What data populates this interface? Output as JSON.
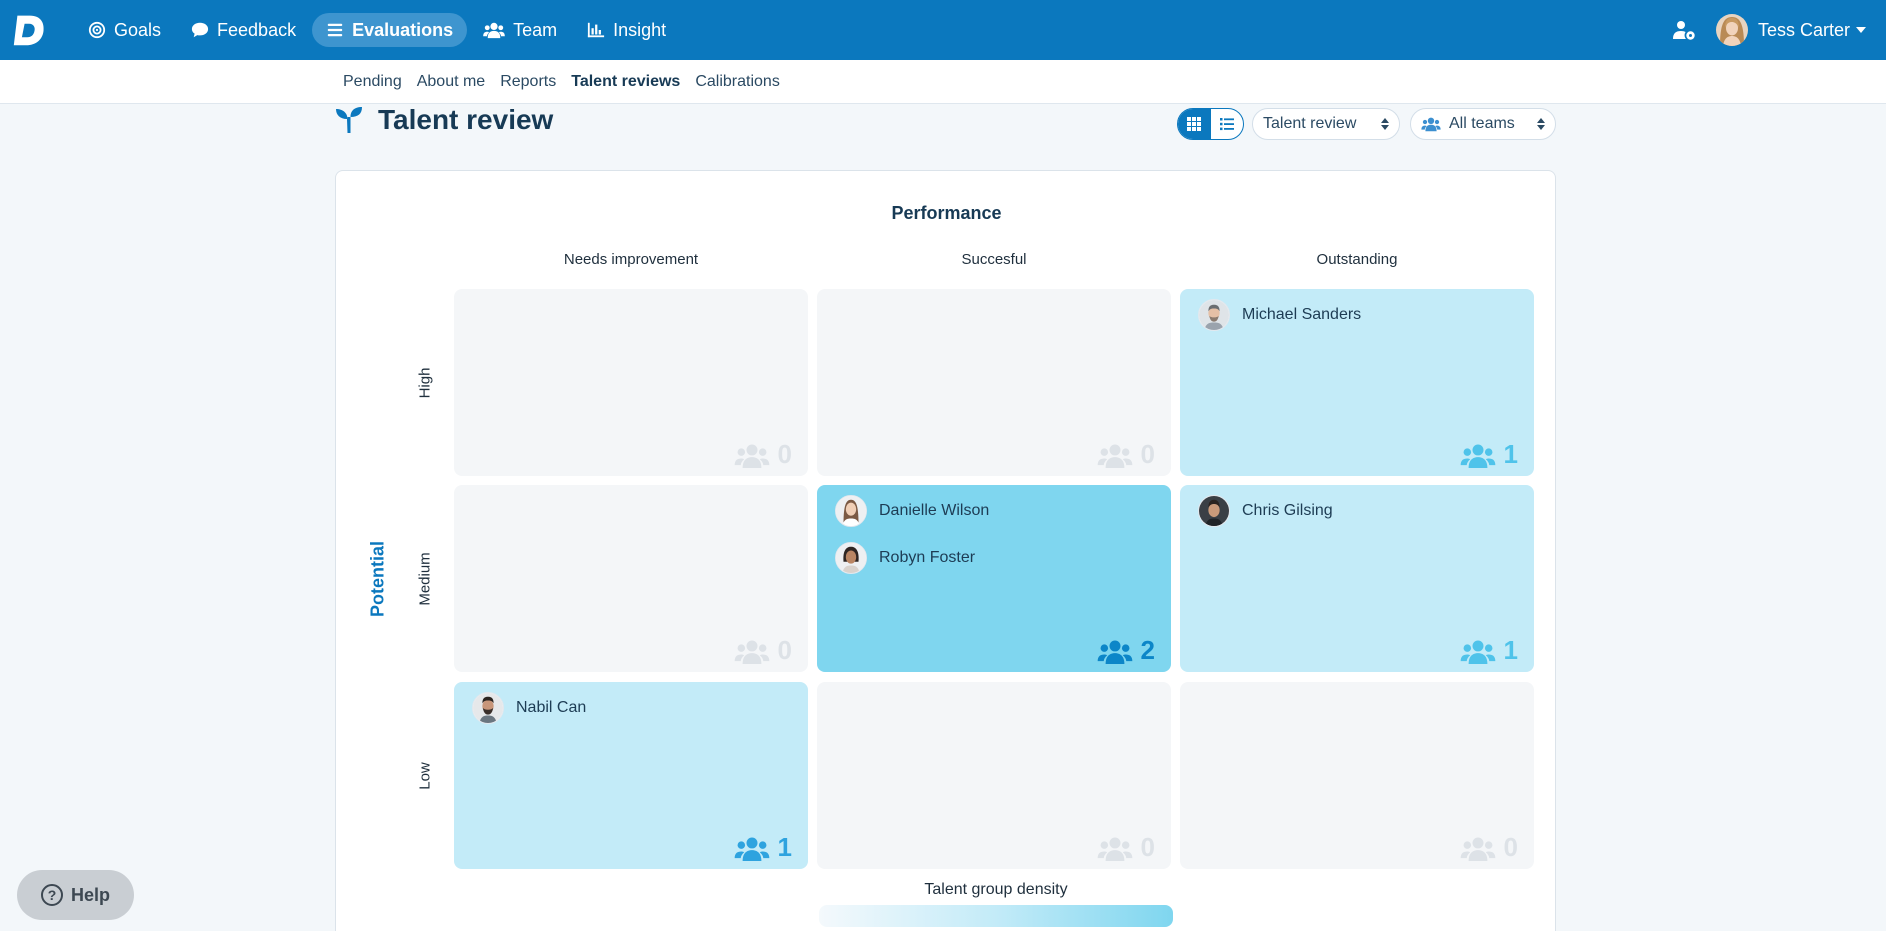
{
  "topbar": {
    "logo_letter": "D",
    "nav": [
      {
        "label": "Goals",
        "icon": "target-icon"
      },
      {
        "label": "Feedback",
        "icon": "chat-bubble-icon"
      },
      {
        "label": "Evaluations",
        "icon": "list-icon",
        "active": true
      },
      {
        "label": "Team",
        "icon": "team-icon"
      },
      {
        "label": "Insight",
        "icon": "bar-chart-icon"
      }
    ],
    "user_name": "Tess Carter"
  },
  "subnav": {
    "items": [
      {
        "label": "Pending"
      },
      {
        "label": "About me"
      },
      {
        "label": "Reports"
      },
      {
        "label": "Talent reviews",
        "active": true
      },
      {
        "label": "Calibrations"
      }
    ]
  },
  "header": {
    "title": "Talent review",
    "view_mode": "grid",
    "review_select": "Talent review",
    "team_select": "All teams"
  },
  "matrix": {
    "x_axis_title": "Performance",
    "y_axis_title": "Potential",
    "columns": [
      "Needs improvement",
      "Succesful",
      "Outstanding"
    ],
    "rows": [
      "High",
      "Medium",
      "Low"
    ],
    "cells": [
      {
        "row": "High",
        "col": "Needs improvement",
        "count": "0",
        "people": []
      },
      {
        "row": "High",
        "col": "Succesful",
        "count": "0",
        "people": []
      },
      {
        "row": "High",
        "col": "Outstanding",
        "count": "1",
        "people": [
          "Michael Sanders"
        ]
      },
      {
        "row": "Medium",
        "col": "Needs improvement",
        "count": "0",
        "people": []
      },
      {
        "row": "Medium",
        "col": "Succesful",
        "count": "2",
        "people": [
          "Danielle Wilson",
          "Robyn Foster"
        ]
      },
      {
        "row": "Medium",
        "col": "Outstanding",
        "count": "1",
        "people": [
          "Chris Gilsing"
        ]
      },
      {
        "row": "Low",
        "col": "Needs improvement",
        "count": "1",
        "people": [
          "Nabil Can"
        ]
      },
      {
        "row": "Low",
        "col": "Succesful",
        "count": "0",
        "people": []
      },
      {
        "row": "Low",
        "col": "Outstanding",
        "count": "0",
        "people": []
      }
    ],
    "legend_label": "Talent group density",
    "density_colors": [
      "#f4f6f8",
      "#c3ebf8",
      "#7fd6ef"
    ]
  },
  "help": {
    "label": "Help"
  },
  "colors": {
    "brand": "#0b78be",
    "title": "#173a55"
  }
}
